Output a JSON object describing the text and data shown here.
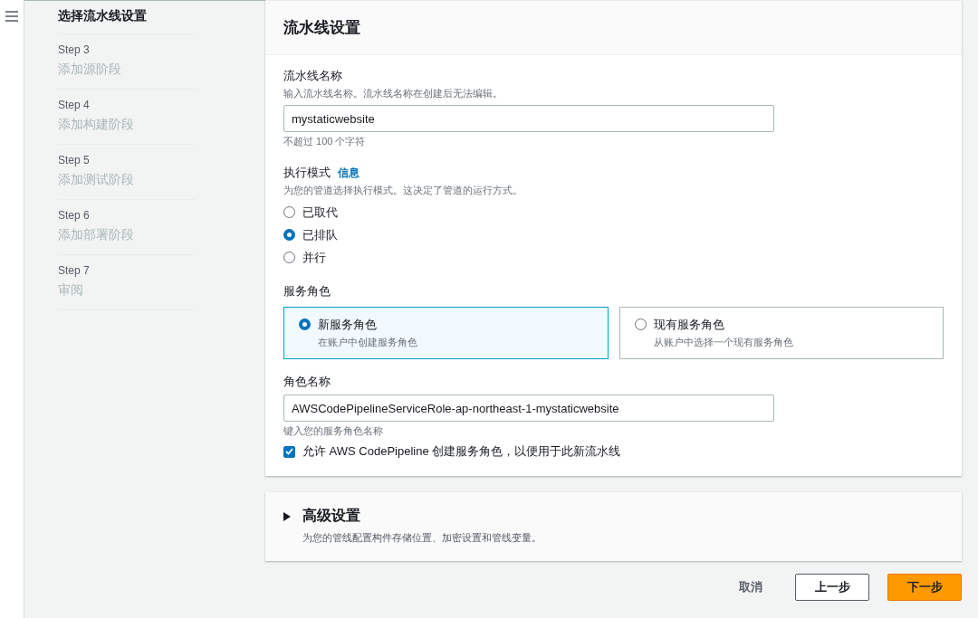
{
  "sidebar": {
    "steps": [
      {
        "title": "选择流水线设置",
        "selected": true
      },
      {
        "step": "Step 3",
        "title": "添加源阶段",
        "selected": false
      },
      {
        "step": "Step 4",
        "title": "添加构建阶段",
        "selected": false
      },
      {
        "step": "Step 5",
        "title": "添加测试阶段",
        "selected": false
      },
      {
        "step": "Step 6",
        "title": "添加部署阶段",
        "selected": false
      },
      {
        "step": "Step 7",
        "title": "审阅",
        "selected": false
      }
    ]
  },
  "settings": {
    "title": "流水线设置",
    "pipeline_name": {
      "label": "流水线名称",
      "description": "输入流水线名称。流水线名称在创建后无法编辑。",
      "value": "mystaticwebsite",
      "constraint": "不超过 100 个字符"
    },
    "execution_mode": {
      "label": "执行模式",
      "info": "信息",
      "description": "为您的管道选择执行模式。这决定了管道的运行方式。",
      "options": [
        {
          "label": "已取代",
          "selected": false
        },
        {
          "label": "已排队",
          "selected": true
        },
        {
          "label": "并行",
          "selected": false
        }
      ]
    },
    "service_role": {
      "label": "服务角色",
      "options": [
        {
          "label": "新服务角色",
          "description": "在账户中创建服务角色",
          "selected": true
        },
        {
          "label": "现有服务角色",
          "description": "从账户中选择一个现有服务角色",
          "selected": false
        }
      ]
    },
    "role_name": {
      "label": "角色名称",
      "value": "AWSCodePipelineServiceRole-ap-northeast-1-mystaticwebsite",
      "constraint": "键入您的服务角色名称"
    },
    "allow_create": {
      "label": "允许 AWS CodePipeline 创建服务角色，以便用于此新流水线",
      "checked": true
    }
  },
  "advanced": {
    "title": "高级设置",
    "description": "为您的管线配置构件存储位置、加密设置和管线变量。",
    "expanded": false
  },
  "buttons": {
    "cancel": "取消",
    "previous": "上一步",
    "next": "下一步"
  }
}
